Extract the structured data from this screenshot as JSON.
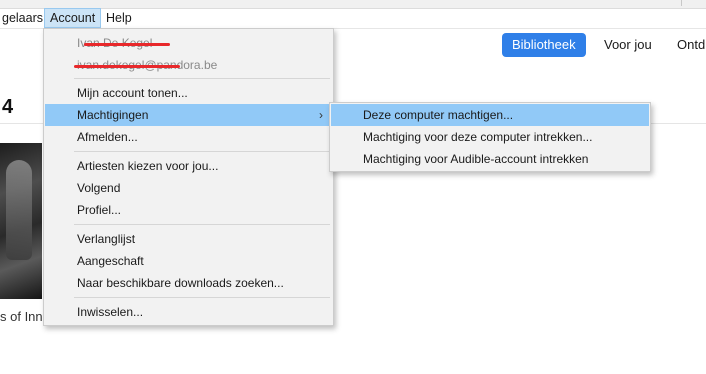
{
  "menubar": {
    "items": [
      {
        "label": "gelaars"
      },
      {
        "label": "Account"
      },
      {
        "label": "Help"
      }
    ]
  },
  "nav": {
    "tabs": [
      {
        "label": "Bibliotheek"
      },
      {
        "label": "Voor jou"
      },
      {
        "label": "Ontd"
      }
    ]
  },
  "page": {
    "heading": "4",
    "album_caption": "s of Inn"
  },
  "account_menu": {
    "user_name": "Ivan De Kegel",
    "user_email": "ivan.dekegel@pandora.be",
    "items": {
      "show_account": "Mijn account tonen...",
      "authorizations": "Machtigingen",
      "sign_out": "Afmelden...",
      "choose_artists": "Artiesten kiezen voor jou...",
      "following": "Volgend",
      "profile": "Profiel...",
      "wishlist": "Verlanglijst",
      "purchased": "Aangeschaft",
      "check_downloads": "Naar beschikbare downloads zoeken...",
      "redeem": "Inwisselen..."
    },
    "submenu_chevron": "›"
  },
  "authorizations_submenu": {
    "items": [
      {
        "label": "Deze computer machtigen..."
      },
      {
        "label": "Machtiging voor deze computer intrekken..."
      },
      {
        "label": "Machtiging voor Audible-account intrekken"
      }
    ]
  },
  "colors": {
    "accent": "#2f7fe8",
    "menu_highlight": "#91c9f7",
    "redaction": "#e8282b"
  }
}
